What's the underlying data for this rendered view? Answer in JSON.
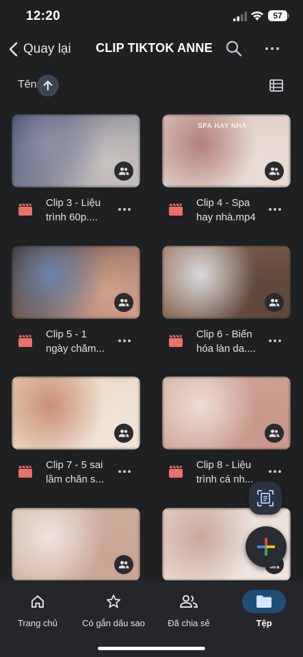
{
  "status_bar": {
    "time": "12:20",
    "battery": "57"
  },
  "header": {
    "back_label": "Quay lại",
    "title": "CLIP TIKTOK ANNE",
    "search_icon": "search-icon",
    "more_icon": "more-vert-icon"
  },
  "sort": {
    "label": "Tên",
    "direction": "ascending",
    "view_icon": "list-view-icon"
  },
  "files": [
    {
      "name_line1": "Clip 3 - Liệu",
      "name_line2": "trình 60p....",
      "thumb_colors": [
        "#3d4a6b",
        "#8e8fa6",
        "#c9c2bf"
      ],
      "thumb_text": ""
    },
    {
      "name_line1": "Clip 4 - Spa",
      "name_line2": "hay nhà.mp4",
      "thumb_colors": [
        "#d7c3b8",
        "#b3807c",
        "#e8dcd4"
      ],
      "thumb_text": "SPA HAY NHÀ"
    },
    {
      "name_line1": "Clip 5 - 1",
      "name_line2": "ngày chăm...",
      "thumb_colors": [
        "#3a2c2a",
        "#6d84a8",
        "#d2a08a"
      ],
      "thumb_text": ""
    },
    {
      "name_line1": "Clip 6 - Biến",
      "name_line2": "hóa làn da....",
      "thumb_colors": [
        "#a07b5f",
        "#d9d9dc",
        "#5c4638"
      ],
      "thumb_text": ""
    },
    {
      "name_line1": "Clip 7 - 5 sai",
      "name_line2": "lầm chăn s...",
      "thumb_colors": [
        "#e6c9ad",
        "#c98f78",
        "#f1e4d8"
      ],
      "thumb_text": ""
    },
    {
      "name_line1": "Clip 8 - Liệu",
      "name_line2": "trình cá nh...",
      "thumb_colors": [
        "#d8b3a6",
        "#eddcd3",
        "#c7988a"
      ],
      "thumb_text": ""
    },
    {
      "name_line1": "",
      "name_line2": "",
      "thumb_colors": [
        "#d9c1b2",
        "#eee3dd",
        "#c8a493"
      ],
      "thumb_text": ""
    },
    {
      "name_line1": "",
      "name_line2": "",
      "thumb_colors": [
        "#e4cfc5",
        "#c9a89a",
        "#f0e6e1"
      ],
      "thumb_text": ""
    }
  ],
  "fab": {
    "scan_icon": "document-scan-icon",
    "add_icon": "plus-icon"
  },
  "bottom_nav": [
    {
      "label": "Trang chủ",
      "icon": "home-icon",
      "active": false
    },
    {
      "label": "Có gắn dấu sao",
      "icon": "star-icon",
      "active": false
    },
    {
      "label": "Đã chia sẻ",
      "icon": "people-icon",
      "active": false
    },
    {
      "label": "Tệp",
      "icon": "folder-icon",
      "active": true
    }
  ],
  "colors": {
    "background": "#1f2022",
    "accent": "#1f4d78",
    "video_icon": "#e8716a"
  }
}
